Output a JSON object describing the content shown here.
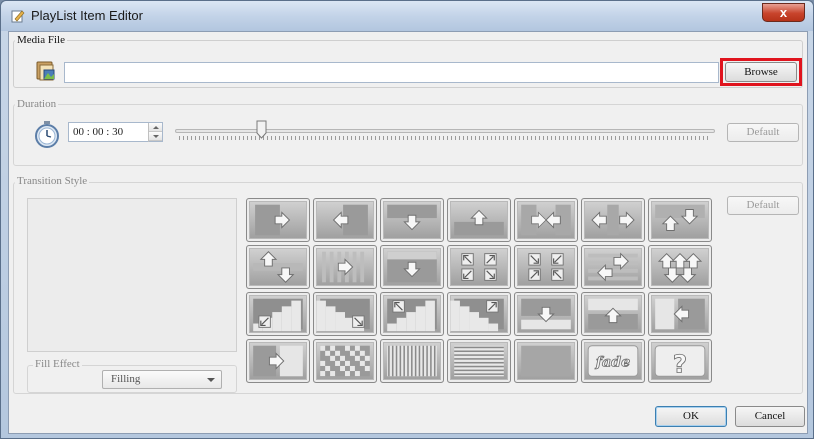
{
  "window": {
    "title": "PlayList Item Editor",
    "close_label": "x",
    "title_icon": "edit-icon"
  },
  "media_file": {
    "group_label": "Media File",
    "icon": "file-folder-icon",
    "path_value": "",
    "browse_label": "Browse",
    "highlight_color": "#e0141e"
  },
  "duration": {
    "group_label": "Duration",
    "icon": "stopwatch-icon",
    "time_value": "00 : 00 : 30",
    "slider_fraction": 0.16,
    "default_label": "Default"
  },
  "transition": {
    "group_label": "Transition Style",
    "default_label": "Default",
    "fill_effect_label": "Fill Effect",
    "fill_effect_value": "Filling",
    "tiles": [
      {
        "icon": "slide-right-icon"
      },
      {
        "icon": "slide-left-icon"
      },
      {
        "icon": "slide-down-icon"
      },
      {
        "icon": "slide-up-icon"
      },
      {
        "icon": "converge-horizontal-icon"
      },
      {
        "icon": "split-horizontal-icon"
      },
      {
        "icon": "split-vertical-icon"
      },
      {
        "icon": "interleave-vertical-icon"
      },
      {
        "icon": "blinds-right-icon"
      },
      {
        "icon": "push-down-icon"
      },
      {
        "icon": "expand-corners-icon"
      },
      {
        "icon": "contract-corners-icon"
      },
      {
        "icon": "interleave-horizontal-icon"
      },
      {
        "icon": "split-arrows-icon"
      },
      {
        "icon": "stairs-down-left-icon"
      },
      {
        "icon": "stairs-down-right-icon"
      },
      {
        "icon": "stairs-up-left-icon"
      },
      {
        "icon": "stairs-up-right-icon"
      },
      {
        "icon": "cover-down-icon"
      },
      {
        "icon": "cover-up-icon"
      },
      {
        "icon": "cover-left-icon"
      },
      {
        "icon": "reveal-right-icon"
      },
      {
        "icon": "dissolve-checker-icon"
      },
      {
        "icon": "vertical-bars-icon"
      },
      {
        "icon": "horizontal-bars-icon"
      },
      {
        "icon": "plain-cut-icon"
      },
      {
        "icon": "fade-icon",
        "text": "fade"
      },
      {
        "icon": "random-icon",
        "text": "?"
      }
    ]
  },
  "footer": {
    "ok_label": "OK",
    "cancel_label": "Cancel"
  }
}
